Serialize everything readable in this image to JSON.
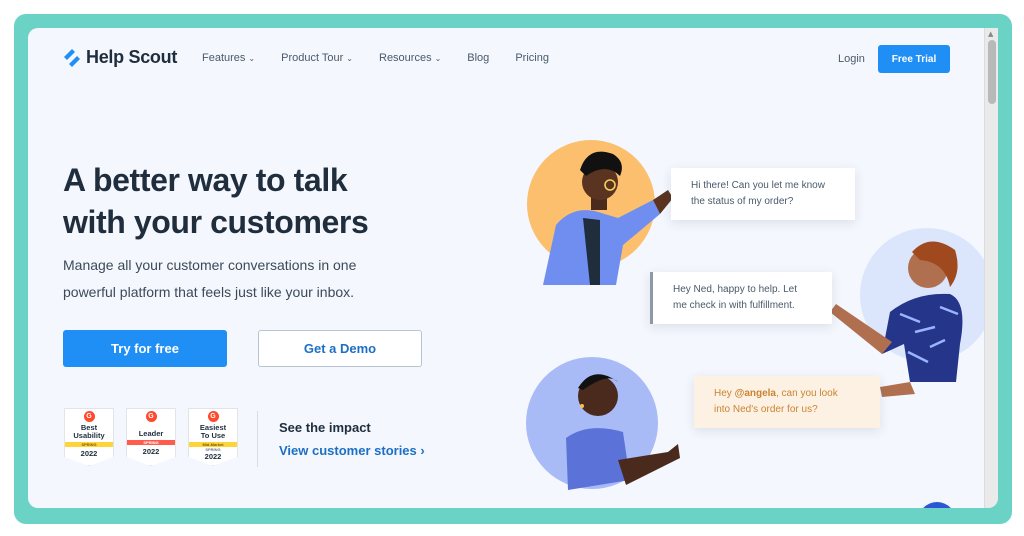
{
  "brand": {
    "name": "Help Scout",
    "accent": "#1f8ff6",
    "frame_color": "#6bd3c6"
  },
  "nav": {
    "items": [
      {
        "label": "Features",
        "dropdown": true
      },
      {
        "label": "Product Tour",
        "dropdown": true
      },
      {
        "label": "Resources",
        "dropdown": true
      },
      {
        "label": "Blog",
        "dropdown": false
      },
      {
        "label": "Pricing",
        "dropdown": false
      }
    ],
    "login": "Login",
    "cta": "Free Trial"
  },
  "hero": {
    "title_line1": "A better way to talk",
    "title_line2": "with your customers",
    "subtitle_line1": "Manage all your customer conversations in one",
    "subtitle_line2": "powerful platform that feels just like your inbox.",
    "primary_cta": "Try for free",
    "secondary_cta": "Get a Demo"
  },
  "badges": [
    {
      "line1": "Best",
      "line2": "Usability",
      "band": "SPRING",
      "year": "2022",
      "style": "yellow"
    },
    {
      "line1": "Leader",
      "line2": "",
      "band": "SPRING",
      "year": "2022",
      "style": "red"
    },
    {
      "line1": "Easiest",
      "line2": "To Use",
      "band": "Mid-Market",
      "band2": "SPRING",
      "year": "2022",
      "style": "yellow"
    }
  ],
  "impact": {
    "label": "See the impact",
    "link": "View customer stories ›"
  },
  "chat": {
    "msg1_line1": "Hi there! Can you let me know",
    "msg1_line2": "the status of my order?",
    "msg2_line1": "Hey Ned, happy to help. Let",
    "msg2_line2": "me check in with fulfillment.",
    "msg3_pre": "Hey ",
    "msg3_mention": "@angela",
    "msg3_post": ", can you look",
    "msg3_line2": "into Ned's order for us?"
  },
  "icons": [
    "help-scout-logo-icon",
    "chevron-down-icon",
    "g2-icon"
  ]
}
